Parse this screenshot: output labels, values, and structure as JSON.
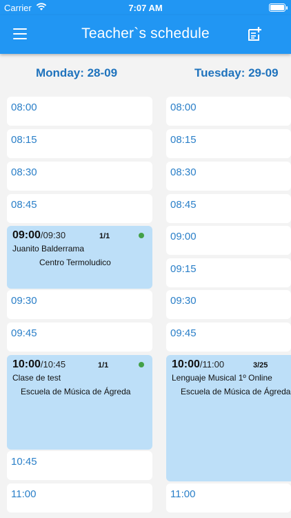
{
  "status_bar": {
    "carrier": "Carrier",
    "time": "7:07 AM"
  },
  "app_bar": {
    "title": "Teacher`s schedule",
    "menu_icon": "hamburger-menu-icon",
    "action_icon": "add-note-icon"
  },
  "colors": {
    "primary": "#2196f3",
    "day_header": "#1f73bd",
    "time_label": "#2a7fc8",
    "event_bg": "#bddff8",
    "status_dot": "#43a047"
  },
  "monday": {
    "header": "Monday: 28-09",
    "slots": [
      "08:00",
      "08:15",
      "08:30",
      "08:45",
      "09:30",
      "09:45",
      "10:45",
      "11:00"
    ],
    "events": [
      {
        "start": "09:00",
        "end": "/09:30",
        "count": "1/1",
        "name": "Juanito Balderrama",
        "place": "Centro Termoludico"
      },
      {
        "start": "10:00",
        "end": "/10:45",
        "count": "1/1",
        "name": "Clase de test",
        "place": "Escuela de Música de Ágreda"
      }
    ]
  },
  "tuesday": {
    "header": "Tuesday: 29-09",
    "slots": [
      "08:00",
      "08:15",
      "08:30",
      "08:45",
      "09:00",
      "09:15",
      "09:30",
      "09:45",
      "11:00"
    ],
    "events": [
      {
        "start": "10:00",
        "end": "/11:00",
        "count": "3/25",
        "name": "Lenguaje Musical 1º Online",
        "place": "Escuela de Música de Ágreda"
      }
    ]
  }
}
